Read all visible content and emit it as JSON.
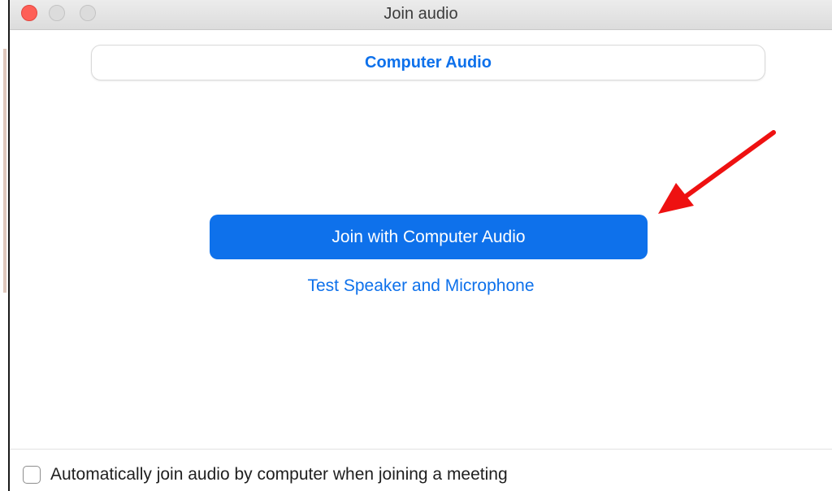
{
  "window": {
    "title": "Join audio",
    "traffic_lights": [
      "close",
      "minimize",
      "maximize"
    ]
  },
  "tabs": [
    {
      "label": "Computer Audio",
      "selected": true
    }
  ],
  "main": {
    "join_button_label": "Join with Computer Audio",
    "test_link_label": "Test Speaker and Microphone"
  },
  "footer": {
    "auto_join_label": "Automatically join audio by computer when joining a meeting",
    "auto_join_checked": false
  },
  "annotation": {
    "arrow_color": "#ee1111",
    "points_to": "join-with-computer-audio-button"
  },
  "colors": {
    "accent": "#0e71eb",
    "close": "#fe5f57"
  }
}
